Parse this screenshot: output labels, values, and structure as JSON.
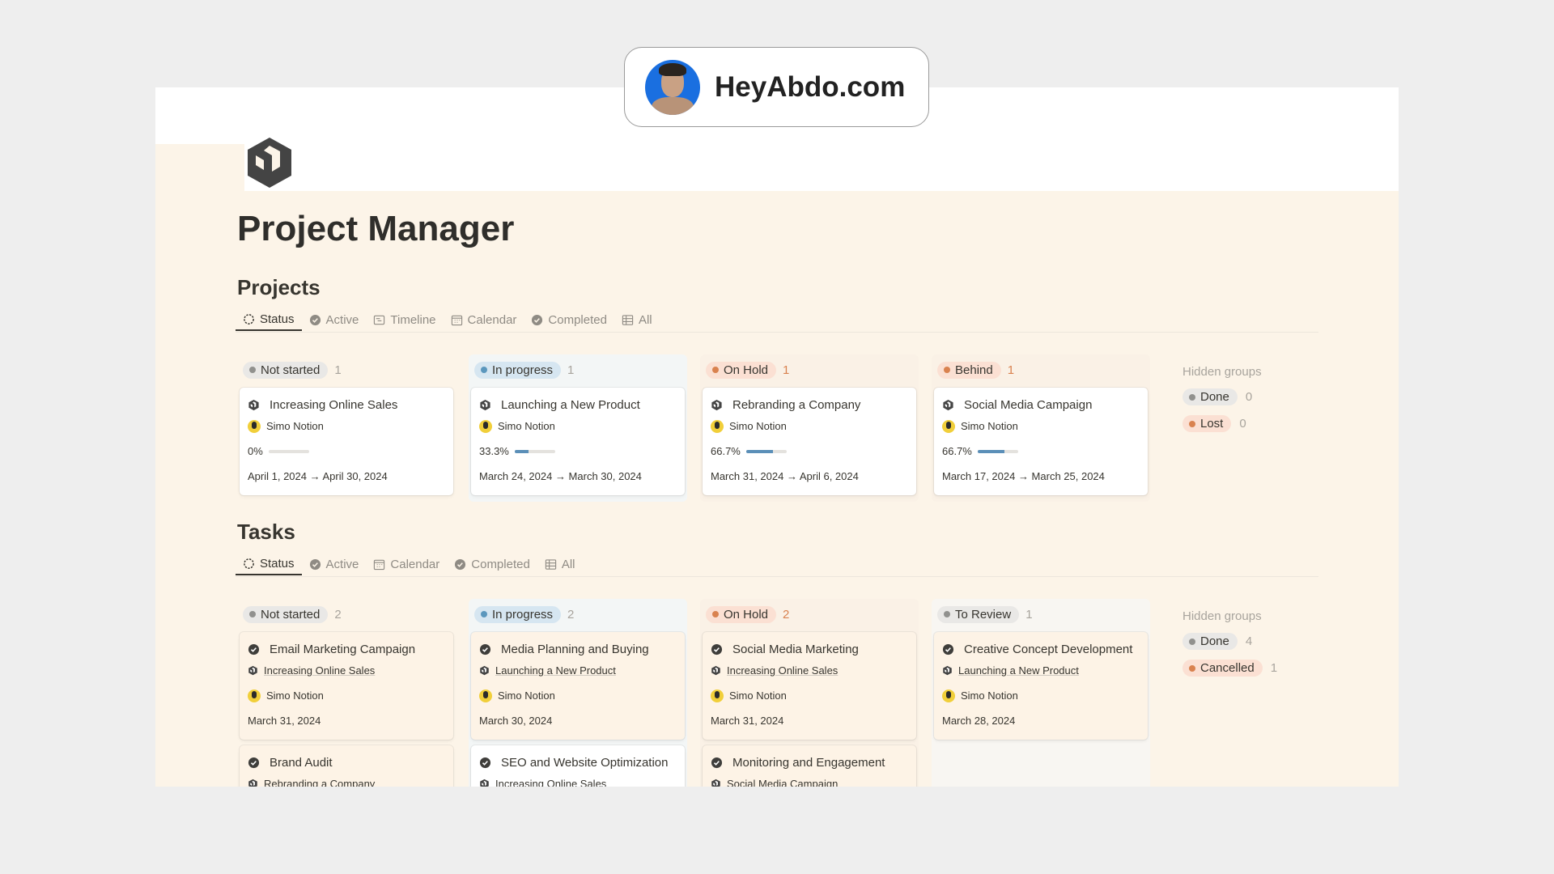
{
  "badge": {
    "text": "HeyAbdo.com"
  },
  "page": {
    "title": "Project Manager"
  },
  "colors": {
    "gray": "#91918e",
    "gray_bg": "#e9e8e6",
    "blue": "#5b97bd",
    "blue_bg": "#d6e6f1",
    "orange": "#d9824f",
    "orange_bg": "#fbe0d3",
    "cream": "#fcf4e8"
  },
  "projects": {
    "title": "Projects",
    "tabs": [
      {
        "label": "Status",
        "icon": "status-icon",
        "active": true
      },
      {
        "label": "Active",
        "icon": "check-circle-icon"
      },
      {
        "label": "Timeline",
        "icon": "timeline-icon"
      },
      {
        "label": "Calendar",
        "icon": "calendar-icon"
      },
      {
        "label": "Completed",
        "icon": "check-circle-icon"
      },
      {
        "label": "All",
        "icon": "table-icon"
      }
    ],
    "columns": [
      {
        "status": "Not started",
        "color": "gray",
        "count": "1",
        "cards": [
          {
            "title": "Increasing Online Sales",
            "owner": "Simo Notion",
            "progress": "0%",
            "progress_value": 0,
            "dates": "April 1, 2024 → April 30, 2024"
          }
        ]
      },
      {
        "status": "In progress",
        "color": "blue",
        "count": "1",
        "cards": [
          {
            "title": "Launching a New Product",
            "owner": "Simo Notion",
            "progress": "33.3%",
            "progress_value": 33.3,
            "dates": "March 24, 2024 → March 30, 2024"
          }
        ]
      },
      {
        "status": "On Hold",
        "color": "orange",
        "count": "1",
        "cards": [
          {
            "title": "Rebranding a Company",
            "owner": "Simo Notion",
            "progress": "66.7%",
            "progress_value": 66.7,
            "dates": "March 31, 2024 → April 6, 2024"
          }
        ]
      },
      {
        "status": "Behind",
        "color": "orange",
        "count": "1",
        "cards": [
          {
            "title": "Social Media Campaign",
            "owner": "Simo Notion",
            "progress": "66.7%",
            "progress_value": 66.7,
            "dates": "March 17, 2024 → March 25, 2024"
          }
        ]
      }
    ],
    "hidden_groups": {
      "label": "Hidden groups",
      "groups": [
        {
          "status": "Done",
          "color": "gray",
          "count": "0"
        },
        {
          "status": "Lost",
          "color": "orange",
          "count": "0"
        }
      ]
    }
  },
  "tasks": {
    "title": "Tasks",
    "tabs": [
      {
        "label": "Status",
        "icon": "status-icon",
        "active": true
      },
      {
        "label": "Active",
        "icon": "check-circle-icon"
      },
      {
        "label": "Calendar",
        "icon": "calendar-icon"
      },
      {
        "label": "Completed",
        "icon": "check-circle-icon"
      },
      {
        "label": "All",
        "icon": "table-icon"
      }
    ],
    "columns": [
      {
        "status": "Not started",
        "color": "gray",
        "count": "2",
        "cards": [
          {
            "title": "Email Marketing Campaign",
            "project": "Increasing Online Sales",
            "owner": "Simo Notion",
            "date": "March 31, 2024"
          },
          {
            "title": "Brand Audit",
            "project": "Rebranding a Company"
          }
        ]
      },
      {
        "status": "In progress",
        "color": "blue",
        "count": "2",
        "cards": [
          {
            "title": "Media Planning and Buying",
            "project": "Launching a New Product",
            "owner": "Simo Notion",
            "date": "March 30, 2024"
          },
          {
            "title": "SEO and Website Optimization",
            "project": "Increasing Online Sales"
          }
        ]
      },
      {
        "status": "On Hold",
        "color": "orange",
        "count": "2",
        "cards": [
          {
            "title": "Social Media Marketing",
            "project": "Increasing Online Sales",
            "owner": "Simo Notion",
            "date": "March 31, 2024"
          },
          {
            "title": "Monitoring and Engagement",
            "project": "Social Media Campaign"
          }
        ]
      },
      {
        "status": "To Review",
        "color": "gray",
        "count": "1",
        "cards": [
          {
            "title": "Creative Concept Development",
            "project": "Launching a New Product",
            "owner": "Simo Notion",
            "date": "March 28, 2024"
          }
        ]
      }
    ],
    "hidden_groups": {
      "label": "Hidden groups",
      "groups": [
        {
          "status": "Done",
          "color": "gray",
          "count": "4"
        },
        {
          "status": "Cancelled",
          "color": "orange",
          "count": "1"
        }
      ]
    }
  }
}
